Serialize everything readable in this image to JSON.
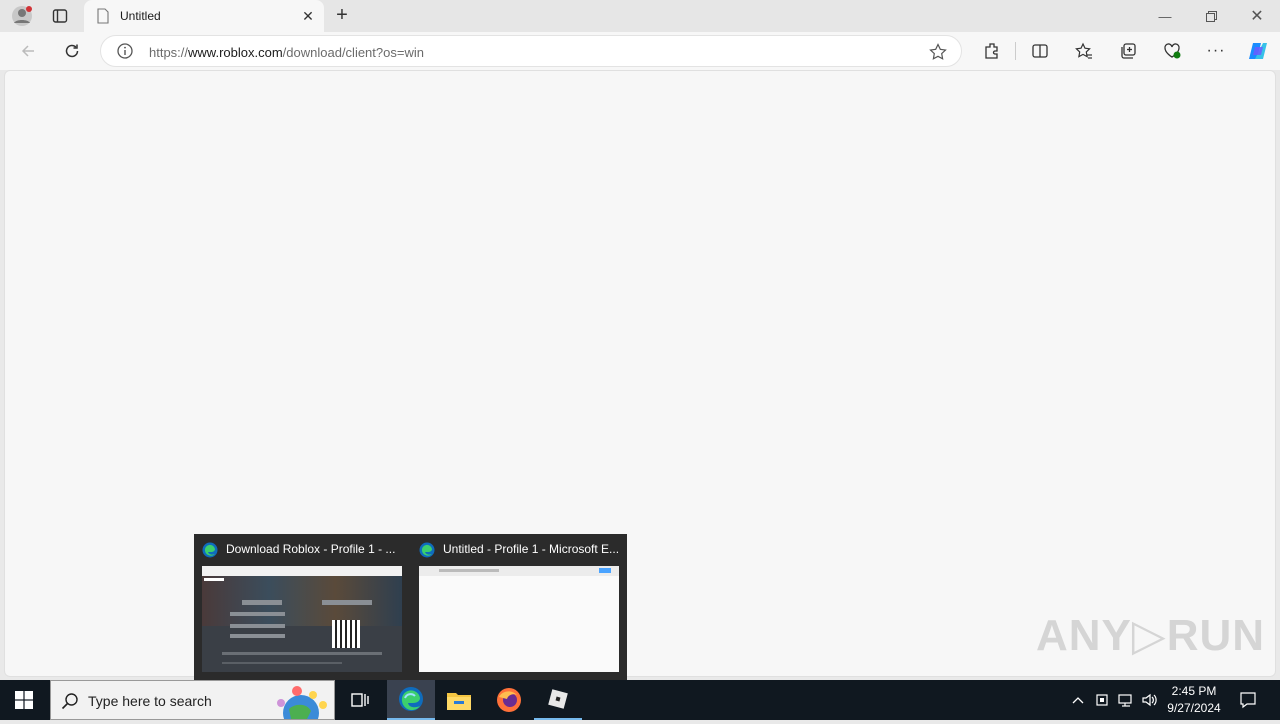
{
  "browser": {
    "tab_title": "Untitled",
    "address": {
      "prefix": "https://",
      "host": "www.roblox.com",
      "path": "/download/client?os=win"
    }
  },
  "taskbar": {
    "search_placeholder": "Type here to search",
    "time": "2:45 PM",
    "date": "9/27/2024"
  },
  "thumbnails": [
    {
      "title": "Download Roblox - Profile 1 - ..."
    },
    {
      "title": "Untitled - Profile 1 - Microsoft E..."
    }
  ],
  "watermark": "ANY▷RUN",
  "colors": {
    "edge_accent": "#0f6cbd",
    "taskbar": "#101820"
  }
}
